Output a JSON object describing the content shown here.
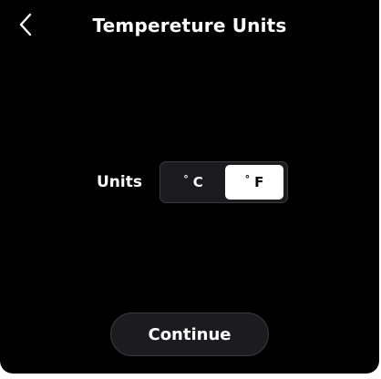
{
  "header": {
    "back_icon": "chevron-left-icon",
    "title": "Tempereture Units"
  },
  "units": {
    "label": "Units",
    "options": [
      {
        "degree": "°",
        "label": "C",
        "selected": false
      },
      {
        "degree": "°",
        "label": "F",
        "selected": true
      }
    ],
    "selected": "F"
  },
  "footer": {
    "continue_label": "Continue"
  },
  "colors": {
    "background": "#000000",
    "text": "#ffffff",
    "selected_segment_bg": "#ffffff",
    "selected_segment_text": "#000000",
    "control_bg": "#1c1c1e"
  }
}
